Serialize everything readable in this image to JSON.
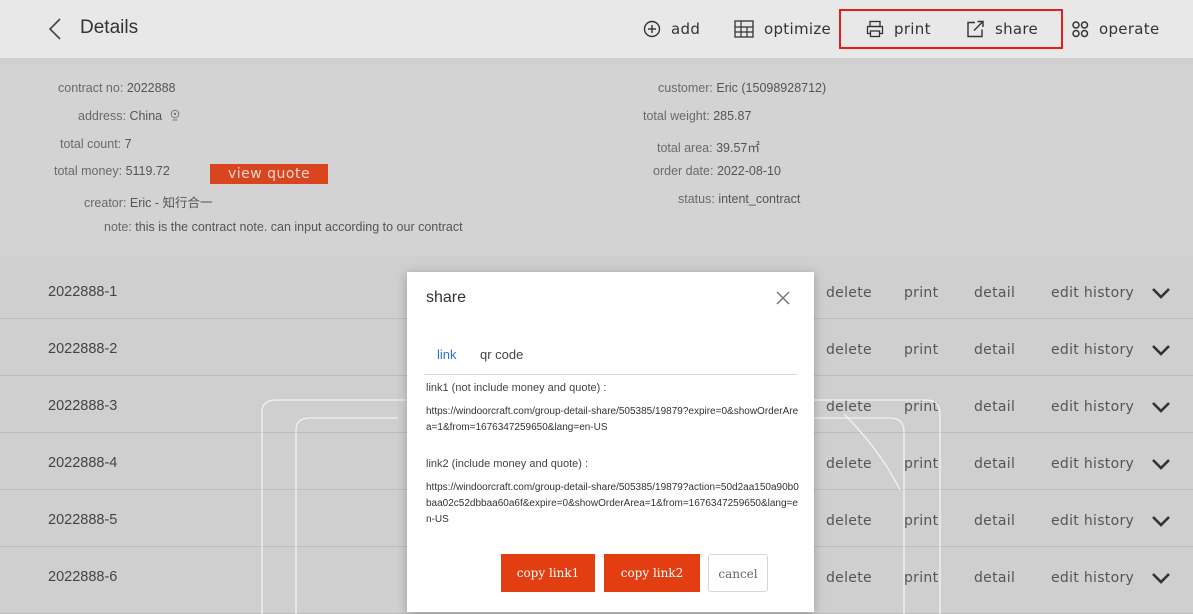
{
  "header": {
    "title": "Details",
    "tools": {
      "add": "add",
      "optimize": "optimize",
      "print": "print",
      "share": "share",
      "operate": "operate"
    },
    "highlight_color": "#e21f1f"
  },
  "info": {
    "contract_no": {
      "label": "contract no:",
      "value": "2022888"
    },
    "address": {
      "label": "address:",
      "value": "China"
    },
    "total_count": {
      "label": "total count:",
      "value": "7"
    },
    "total_money": {
      "label": "total money:",
      "value": "5119.72"
    },
    "view_quote": "view quote",
    "creator": {
      "label": "creator:",
      "value": "Eric - 知行合一"
    },
    "note": {
      "label": "note:",
      "value": "this is the contract note. can input according to our contract"
    },
    "customer": {
      "label": "customer:",
      "value": "Eric  (15098928712)"
    },
    "total_weight": {
      "label": "total weight:",
      "value": "285.87"
    },
    "total_area": {
      "label": "total area:",
      "value": "39.57㎡"
    },
    "order_date": {
      "label": "order date:",
      "value": "2022-08-10"
    },
    "status": {
      "label": "status:",
      "value": "intent_contract"
    }
  },
  "rows": [
    {
      "id": "2022888-1"
    },
    {
      "id": "2022888-2"
    },
    {
      "id": "2022888-3"
    },
    {
      "id": "2022888-4"
    },
    {
      "id": "2022888-5"
    },
    {
      "id": "2022888-6"
    }
  ],
  "row_actions": {
    "delete": "delete",
    "print": "print",
    "detail": "detail",
    "edit_history": "edit history"
  },
  "modal": {
    "title": "share",
    "tabs": {
      "link": "link",
      "qr": "qr code"
    },
    "link1_heading": "link1  (not include money and quote) :",
    "link1_url": "https://windoorcraft.com/group-detail-share/505385/19879?expire=0&showOrderArea=1&from=1676347259650&lang=en-US",
    "link2_heading": "link2  (include money and quote) :",
    "link2_url": "https://windoorcraft.com/group-detail-share/505385/19879?action=50d2aa150a90b0baa02c52dbbaa60a6f&expire=0&showOrderArea=1&from=1676347259650&lang=en-US",
    "copy1": "copy link1",
    "copy2": "copy link2",
    "cancel": "cancel",
    "accent": "#e33d12"
  }
}
